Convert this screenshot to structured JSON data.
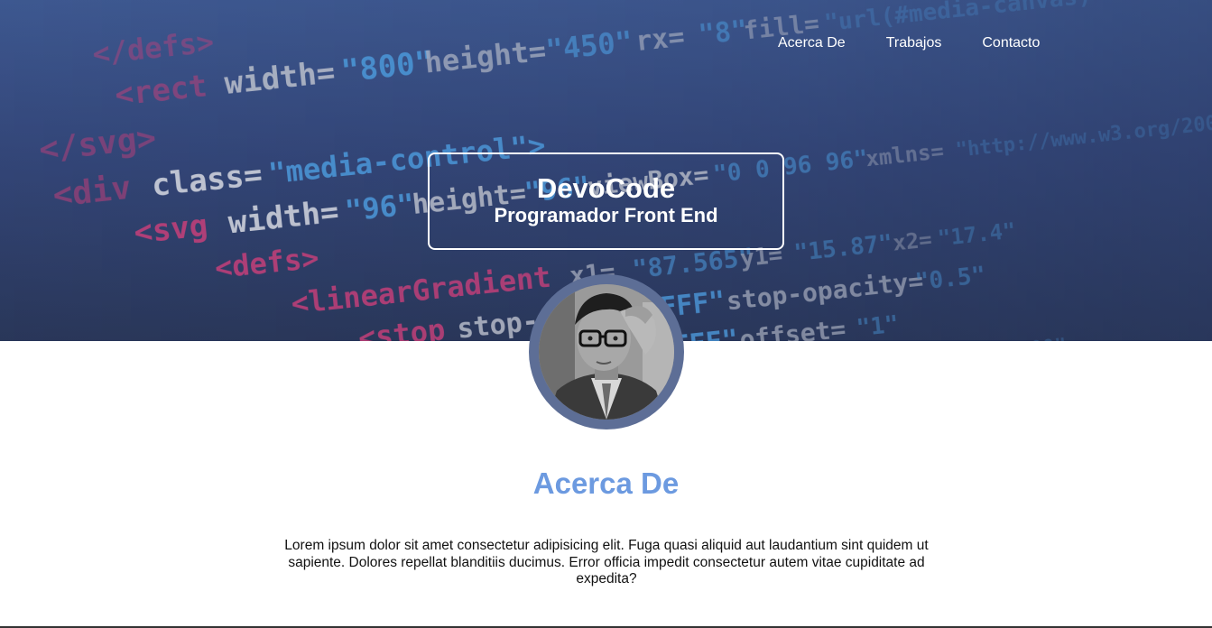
{
  "nav": {
    "items": [
      {
        "label": "Acerca De"
      },
      {
        "label": "Trabajos"
      },
      {
        "label": "Contacto"
      }
    ]
  },
  "hero": {
    "brand": "DevoCode",
    "role": "Programador Front End",
    "background_icon": "code-editor-background"
  },
  "profile": {
    "avatar_icon": "profile-photo"
  },
  "about": {
    "title": "Acerca De",
    "text": "Lorem ipsum dolor sit amet consectetur adipisicing elit. Fuga quasi aliquid aut laudantium sint quidem ut sapiente. Dolores repellat blanditiis ducimus. Error officia impedit consectetur autem vitae cupiditate ad expedita?"
  },
  "colors": {
    "accent": "#6c9ae0",
    "hero_bg": "#3f5a93",
    "code_pink": "#e0457b",
    "code_blue": "#4fa3e8",
    "code_gray": "#c7cbd6"
  }
}
